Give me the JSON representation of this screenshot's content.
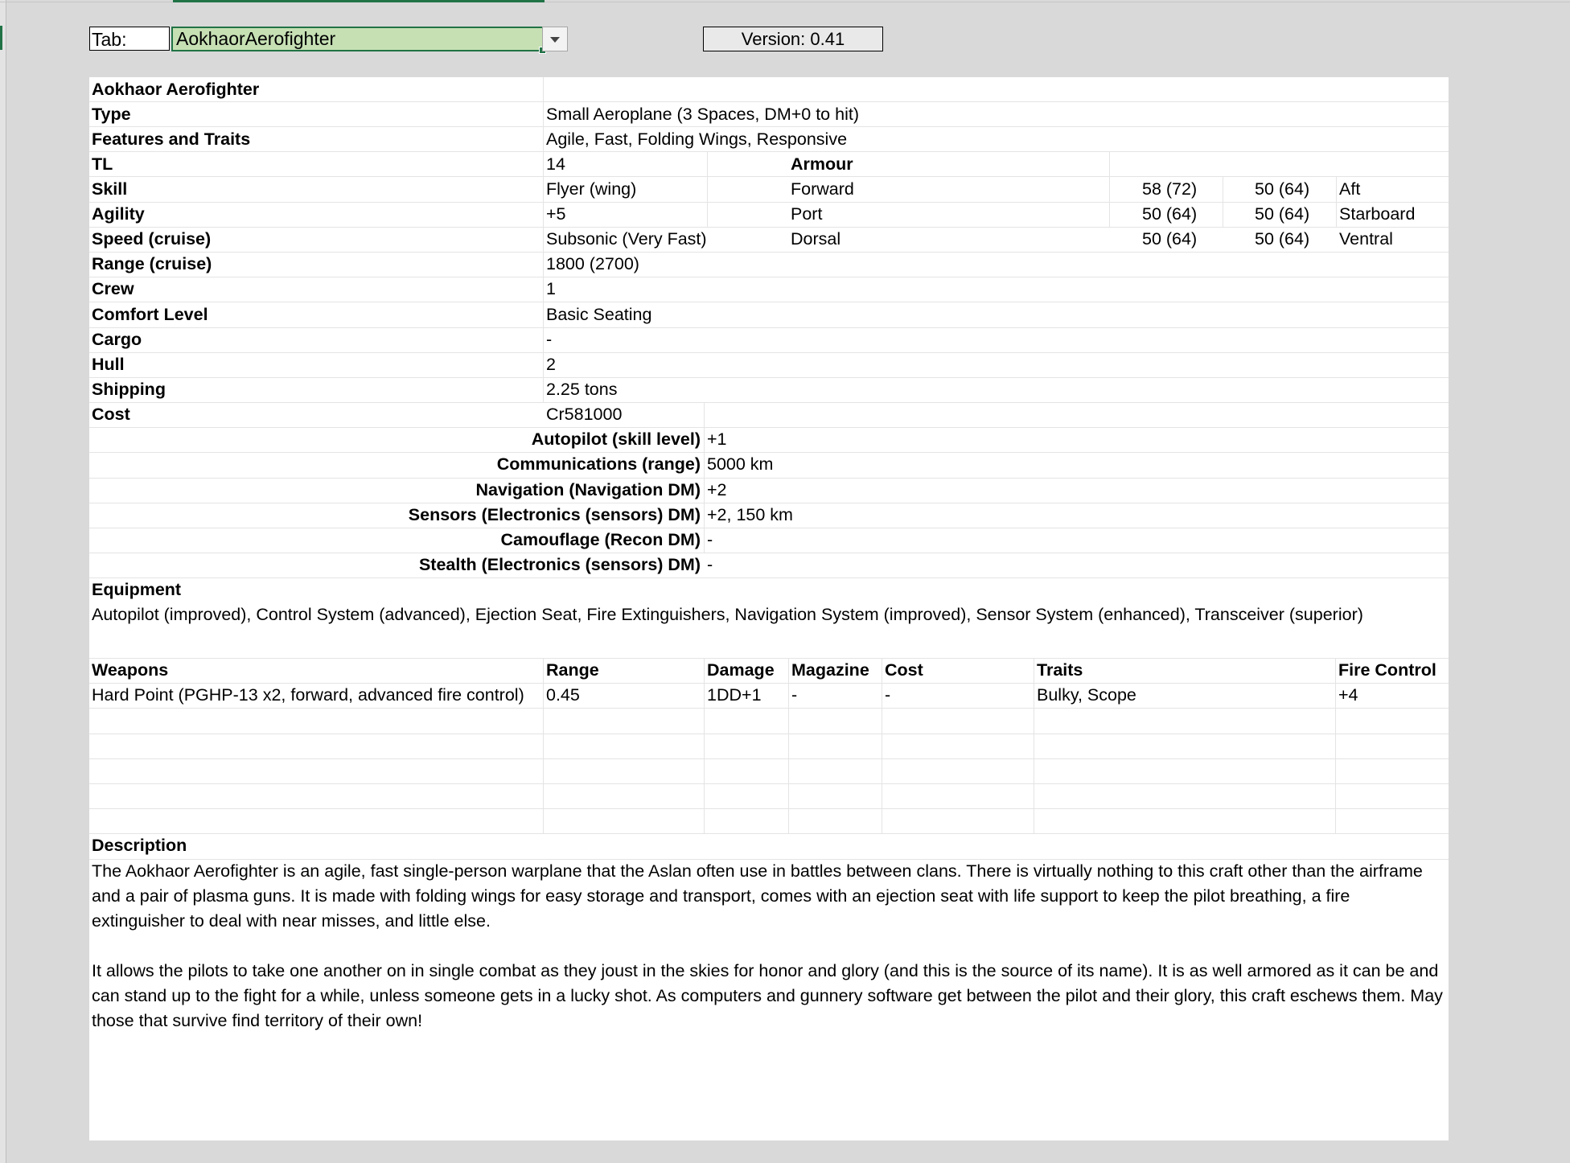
{
  "toolbar": {
    "tab_label": "Tab:",
    "tab_value": "AokhaorAerofighter",
    "version": "Version: 0.41"
  },
  "sheet": {
    "title": "Aokhaor Aerofighter",
    "specs": [
      {
        "label": "Type",
        "value": "Small Aeroplane (3 Spaces, DM+0 to hit)"
      },
      {
        "label": "Features and Traits",
        "value": "Agile, Fast, Folding Wings, Responsive"
      },
      {
        "label": "TL",
        "value": "14"
      },
      {
        "label": "Skill",
        "value": "Flyer (wing)"
      },
      {
        "label": "Agility",
        "value": "+5"
      },
      {
        "label": "Speed (cruise)",
        "value": "Subsonic (Very Fast)"
      },
      {
        "label": "Range (cruise)",
        "value": "1800 (2700)"
      },
      {
        "label": "Crew",
        "value": "1"
      },
      {
        "label": "Comfort Level",
        "value": "Basic Seating"
      },
      {
        "label": "Cargo",
        "value": "-"
      },
      {
        "label": "Hull",
        "value": "2"
      },
      {
        "label": "Shipping",
        "value": "2.25 tons"
      },
      {
        "label": "Cost",
        "value": "Cr581000"
      }
    ],
    "armour": {
      "header": "Armour",
      "rows": [
        {
          "side_a": "Forward",
          "val_a": "58 (72)",
          "val_b": "50 (64)",
          "side_b": "Aft"
        },
        {
          "side_a": "Port",
          "val_a": "50 (64)",
          "val_b": "50 (64)",
          "side_b": "Starboard"
        },
        {
          "side_a": "Dorsal",
          "val_a": "50 (64)",
          "val_b": "50 (64)",
          "side_b": "Ventral"
        }
      ]
    },
    "systems": [
      {
        "label": "Autopilot (skill level)",
        "value": "+1"
      },
      {
        "label": "Communications (range)",
        "value": "5000 km"
      },
      {
        "label": "Navigation (Navigation DM)",
        "value": "+2"
      },
      {
        "label": "Sensors (Electronics (sensors) DM)",
        "value": "+2, 150 km"
      },
      {
        "label": "Camouflage (Recon DM)",
        "value": "-"
      },
      {
        "label": "Stealth (Electronics (sensors) DM)",
        "value": "-"
      }
    ],
    "equipment": {
      "header": "Equipment",
      "text": "Autopilot (improved), Control System (advanced), Ejection Seat, Fire Extinguishers, Navigation System (improved), Sensor System (enhanced), Transceiver (superior)"
    },
    "weapons": {
      "headers": {
        "weapon": "Weapons",
        "range": "Range",
        "damage": "Damage",
        "magazine": "Magazine",
        "cost": "Cost",
        "traits": "Traits",
        "fire_control": "Fire Control"
      },
      "rows": [
        {
          "weapon": "Hard Point (PGHP-13 x2, forward, advanced fire control)",
          "range": "0.45",
          "damage": "1DD+1",
          "magazine": "-",
          "cost": "-",
          "traits": "Bulky, Scope",
          "fire_control": "+4"
        }
      ]
    },
    "description": {
      "header": "Description",
      "p1": "The Aokhaor Aerofighter is an agile, fast single-person warplane that the Aslan often use in battles between clans. There is virtually nothing to this craft other than the airframe and a pair of plasma guns. It is made with folding wings for easy storage and transport, comes with an ejection seat with life support to keep the pilot breathing, a fire extinguisher to deal with near misses, and little else.",
      "p2": "It allows the pilots to take one another on in single combat as they joust in the skies for honor and glory (and this is the source of its name). It is as well armored as it can be and can stand up to the fight for a while, unless someone gets in a lucky shot. As computers and gunnery software get between the pilot and their glory, this craft eschews them. May those that survive find territory of their own!"
    }
  }
}
